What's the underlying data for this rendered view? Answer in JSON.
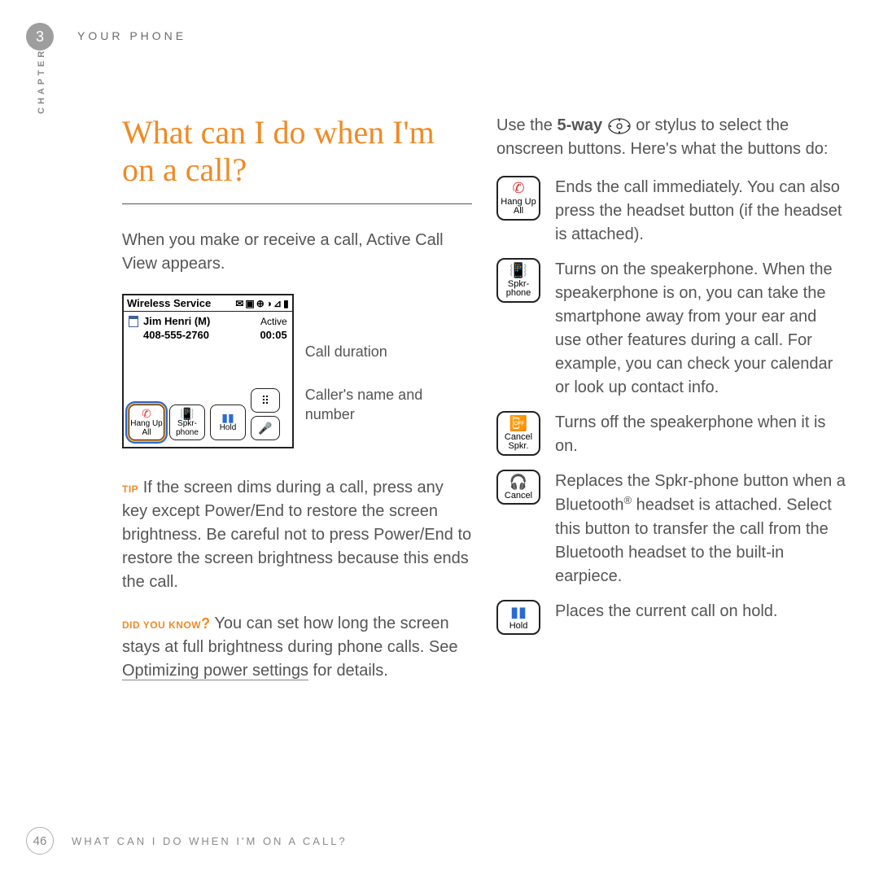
{
  "header": {
    "chapter_num": "3",
    "title": "YOUR PHONE",
    "side_label": "CHAPTER"
  },
  "main": {
    "heading": "What can I do when I'm on a call?",
    "intro": "When you make or receive a call, Active Call View appears.",
    "phone": {
      "carrier": "Wireless Service",
      "caller_name": "Jim Henri (M)",
      "caller_status": "Active",
      "caller_number": "408-555-2760",
      "duration": "00:05",
      "btn_hangup": "Hang Up All",
      "btn_spkr": "Spkr-phone",
      "btn_hold": "Hold"
    },
    "callouts": {
      "duration": "Call duration",
      "caller": "Caller's name and number"
    },
    "tip": {
      "tag": "TIP",
      "text": "If the screen dims during a call, press any key except Power/End to restore the screen brightness. Be careful not to press Power/End to restore the screen brightness because this ends the call."
    },
    "dyk": {
      "tag": "DID YOU KNOW",
      "text1": "You can set how long the screen stays at full brightness during phone calls. See ",
      "link": "Optimizing power settings",
      "text2": " for details."
    }
  },
  "right": {
    "intro1": "Use the ",
    "bold5way": "5-way",
    "intro2": " or stylus to select the onscreen buttons. Here's what the buttons do:",
    "btns": [
      {
        "label": "Hang Up All",
        "desc": "Ends the call immediately. You can also press the headset button (if the headset is attached)."
      },
      {
        "label": "Spkr-phone",
        "desc": "Turns on the speakerphone. When the speakerphone is on, you can take the smartphone away from your ear and use other features during a call. For example, you can check your calendar or look up contact info."
      },
      {
        "label": "Cancel Spkr.",
        "desc": "Turns off the speakerphone when it is on."
      },
      {
        "label": "Cancel",
        "desc": "Replaces the Spkr-phone button when a Bluetooth",
        "regsuffix": " headset is attached. Select this button to transfer the call from the Bluetooth headset to the built-in earpiece."
      },
      {
        "label": "Hold",
        "desc": "Places the current call on hold."
      }
    ]
  },
  "footer": {
    "page_num": "46",
    "title": "WHAT CAN I DO WHEN I'M ON A CALL?"
  }
}
